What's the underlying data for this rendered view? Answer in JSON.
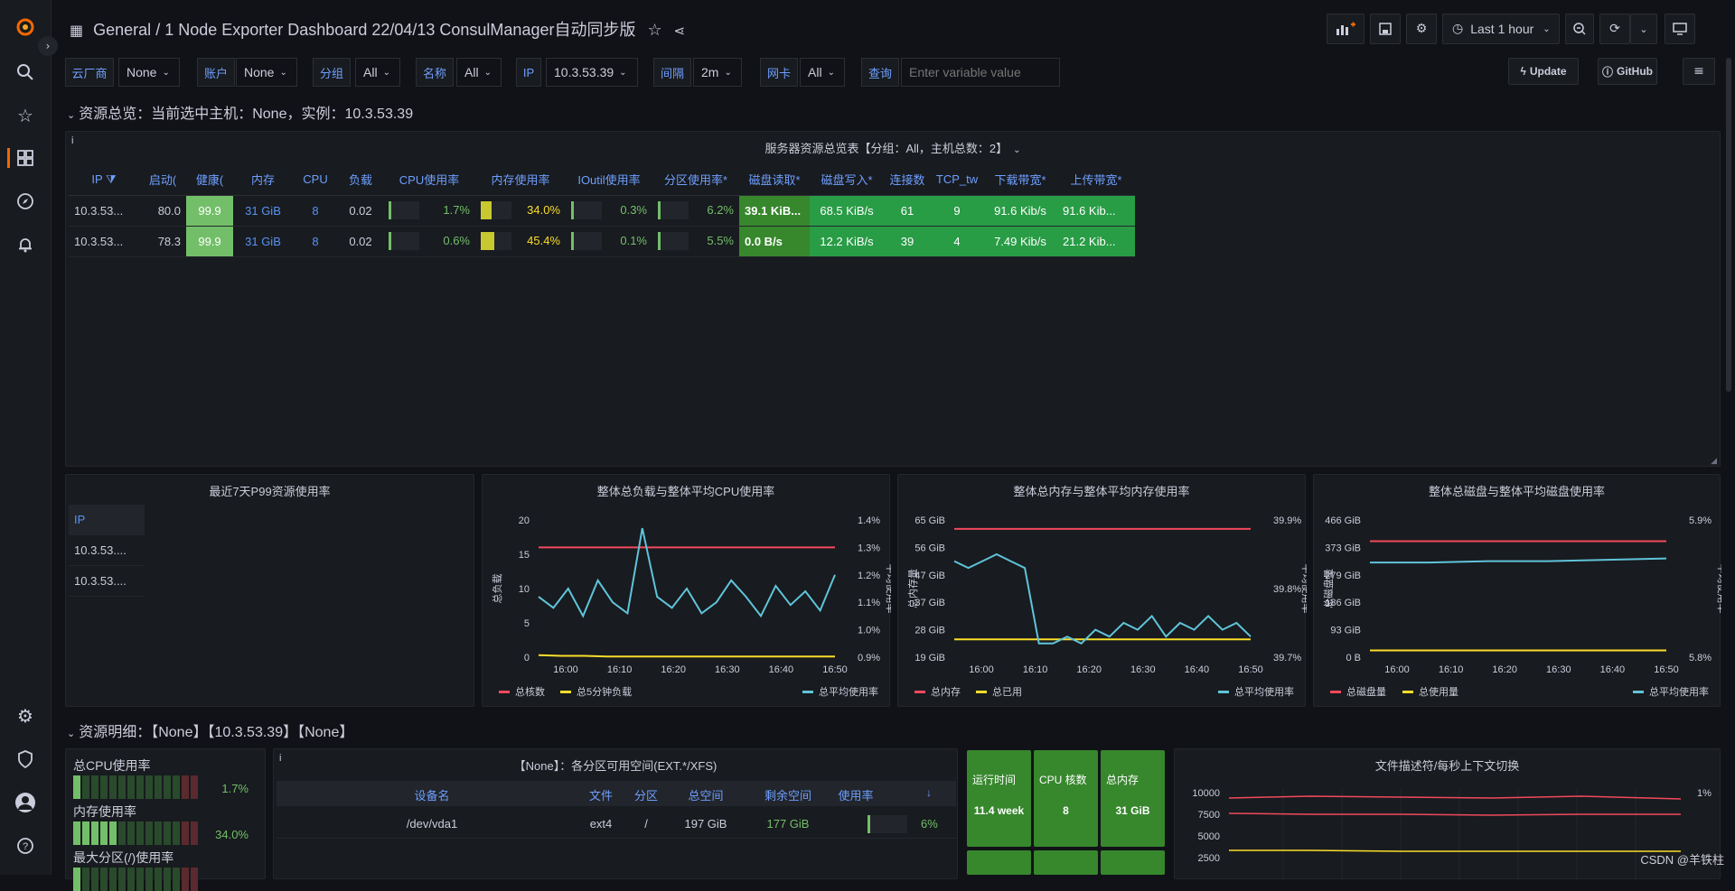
{
  "header": {
    "breadcrumb_root": "General",
    "breadcrumb_sep": " / ",
    "dashboard_title": "1 Node Exporter Dashboard 22/04/13 ConsulManager自动同步版",
    "time_range": "Last 1 hour"
  },
  "variables": [
    {
      "label": "云厂商",
      "value": "None"
    },
    {
      "label": "账户",
      "value": "None"
    },
    {
      "label": "分组",
      "value": "All"
    },
    {
      "label": "名称",
      "value": "All"
    },
    {
      "label": "IP",
      "value": "10.3.53.39"
    },
    {
      "label": "间隔",
      "value": "2m"
    },
    {
      "label": "网卡",
      "value": "All"
    },
    {
      "label": "查询",
      "placeholder": "Enter variable value"
    }
  ],
  "buttons": {
    "update": "Update",
    "github": "GitHub"
  },
  "rows": {
    "overview": "资源总览：当前选中主机：None，实例：10.3.53.39",
    "detail": "资源明细：【None】【10.3.53.39】【None】"
  },
  "server_table": {
    "title": "服务器资源总览表【分组：All，主机总数：2】",
    "columns": [
      "IP",
      "启动(",
      "健康(",
      "内存",
      "CPU",
      "负载",
      "CPU使用率",
      "内存使用率",
      "IOutil使用率",
      "分区使用率*",
      "磁盘读取*",
      "磁盘写入*",
      "连接数",
      "TCP_tw",
      "下载带宽*",
      "上传带宽*"
    ],
    "rows": [
      {
        "ip": "10.3.53...",
        "uptime": "80.0",
        "health": "99.9",
        "mem": "31 GiB",
        "cpu": "8",
        "load": "0.02",
        "cpu_pct": "1.7%",
        "cpu_frac": 0.017,
        "mem_pct": "34.0%",
        "mem_frac": 0.34,
        "io_pct": "0.3%",
        "io_frac": 0.003,
        "part_pct": "6.2%",
        "part_frac": 0.062,
        "disk_read": "39.1 KiB...",
        "disk_write": "68.5 KiB/s",
        "conn": "61",
        "tcp_tw": "9",
        "down": "91.6 Kib/s",
        "up": "91.6 Kib..."
      },
      {
        "ip": "10.3.53...",
        "uptime": "78.3",
        "health": "99.9",
        "mem": "31 GiB",
        "cpu": "8",
        "load": "0.02",
        "cpu_pct": "0.6%",
        "cpu_frac": 0.006,
        "mem_pct": "45.4%",
        "mem_frac": 0.454,
        "io_pct": "0.1%",
        "io_frac": 0.001,
        "part_pct": "5.5%",
        "part_frac": 0.055,
        "disk_read": "0.0 B/s",
        "disk_write": "12.2 KiB/s",
        "conn": "39",
        "tcp_tw": "4",
        "down": "7.49 Kib/s",
        "up": "21.2 Kib..."
      }
    ]
  },
  "p99_panel": {
    "title": "最近7天P99资源使用率",
    "header": "IP",
    "rows": [
      "10.3.53....",
      "10.3.53...."
    ]
  },
  "chart_data": [
    {
      "type": "line",
      "title": "整体总负载与整体平均CPU使用率",
      "ylabel": "总负载",
      "y2label": "平均使用率",
      "x": [
        "16:00",
        "16:10",
        "16:20",
        "16:30",
        "16:40",
        "16:50"
      ],
      "ylim": [
        0,
        20
      ],
      "y_ticks": [
        "0",
        "5",
        "10",
        "15",
        "20"
      ],
      "y2lim": [
        0.9,
        1.4
      ],
      "y2_ticks": [
        "0.9%",
        "1.0%",
        "1.1%",
        "1.2%",
        "1.3%",
        "1.4%"
      ],
      "series": [
        {
          "name": "总核数",
          "color": "#f2495c",
          "axis": "left",
          "values": [
            16,
            16,
            16,
            16,
            16,
            16,
            16,
            16,
            16,
            16,
            16,
            16,
            16,
            16
          ]
        },
        {
          "name": "总5分钟负载",
          "color": "#fade2a",
          "axis": "left",
          "values": [
            0.3,
            0.2,
            0.2,
            0.1,
            0.1,
            0.1,
            0.1,
            0.1,
            0.1,
            0.1,
            0.1,
            0.1,
            0.1,
            0.1
          ]
        },
        {
          "name": "总平均使用率",
          "color": "#5fc4da",
          "axis": "right",
          "values": [
            1.12,
            1.08,
            1.15,
            1.05,
            1.18,
            1.1,
            1.06,
            1.37,
            1.12,
            1.08,
            1.15,
            1.06,
            1.1,
            1.18,
            1.12,
            1.05,
            1.16,
            1.09,
            1.14,
            1.07,
            1.2
          ]
        }
      ]
    },
    {
      "type": "line",
      "title": "整体总内存与整体平均内存使用率",
      "ylabel": "总内存量",
      "y2label": "平均使用率",
      "x": [
        "16:00",
        "16:10",
        "16:20",
        "16:30",
        "16:40",
        "16:50"
      ],
      "ylim": [
        19,
        65
      ],
      "y_ticks": [
        "19 GiB",
        "28 GiB",
        "37 GiB",
        "47 GiB",
        "56 GiB",
        "65 GiB"
      ],
      "y2lim": [
        39.7,
        39.9
      ],
      "y2_ticks": [
        "39.7%",
        "39.8%",
        "39.9%"
      ],
      "series": [
        {
          "name": "总内存",
          "color": "#f2495c",
          "axis": "left",
          "values": [
            62,
            62,
            62,
            62,
            62,
            62,
            62,
            62,
            62,
            62,
            62,
            62,
            62,
            62
          ]
        },
        {
          "name": "总已用",
          "color": "#fade2a",
          "axis": "left",
          "values": [
            25,
            25,
            25,
            25,
            25,
            25,
            25,
            25,
            25,
            25,
            25,
            25,
            25,
            25
          ]
        },
        {
          "name": "总平均使用率",
          "color": "#5fc4da",
          "axis": "right",
          "values": [
            39.84,
            39.83,
            39.84,
            39.85,
            39.84,
            39.83,
            39.72,
            39.72,
            39.73,
            39.72,
            39.74,
            39.73,
            39.75,
            39.74,
            39.76,
            39.73,
            39.75,
            39.74,
            39.76,
            39.74,
            39.75,
            39.73
          ]
        }
      ]
    },
    {
      "type": "line",
      "title": "整体总磁盘与整体平均磁盘使用率",
      "ylabel": "总磁盘量",
      "y2label": "平均使用率",
      "x": [
        "16:00",
        "16:10",
        "16:20",
        "16:30",
        "16:40",
        "16:50"
      ],
      "ylim": [
        0,
        466
      ],
      "y_ticks": [
        "0 B",
        "93 GiB",
        "186 GiB",
        "279 GiB",
        "373 GiB",
        "466 GiB"
      ],
      "y2lim": [
        5.8,
        5.9
      ],
      "y2_ticks": [
        "5.8%",
        "5.9%"
      ],
      "series": [
        {
          "name": "总磁盘量",
          "color": "#f2495c",
          "axis": "left",
          "values": [
            394,
            394,
            394,
            394,
            394,
            394
          ]
        },
        {
          "name": "总使用量",
          "color": "#fade2a",
          "axis": "left",
          "values": [
            23,
            23,
            23,
            23,
            23,
            23
          ]
        },
        {
          "name": "总平均使用率",
          "color": "#5fc4da",
          "axis": "right",
          "values": [
            5.869,
            5.869,
            5.87,
            5.87,
            5.871,
            5.872
          ]
        }
      ]
    }
  ],
  "gauges": [
    {
      "label": "总CPU使用率",
      "value": "1.7%",
      "frac": 0.017
    },
    {
      "label": "内存使用率",
      "value": "34.0%",
      "frac": 0.34
    },
    {
      "label": "最大分区(/)使用率",
      "value": "",
      "frac": 0.06
    }
  ],
  "partition_panel": {
    "title": "【None】：各分区可用空间(EXT.*/XFS)",
    "columns": [
      "设备名",
      "文件",
      "分区",
      "总空间",
      "剩余空间",
      "使用率"
    ],
    "rows": [
      {
        "dev": "/dev/vda1",
        "fs": "ext4",
        "mount": "/",
        "total": "197 GiB",
        "free": "177 GiB",
        "pct": "6%",
        "frac": 0.06
      }
    ]
  },
  "stats": [
    {
      "label": "运行时间",
      "value": "11.4 week"
    },
    {
      "label": "CPU 核数",
      "value": "8"
    },
    {
      "label": "总内存",
      "value": "31 GiB"
    }
  ],
  "fd_panel": {
    "title": "文件描述符/每秒上下文切换",
    "y_ticks": [
      "10000",
      "7500",
      "5000",
      "2500"
    ],
    "y2_tick": "1%"
  },
  "watermark": "CSDN @羊铁柱"
}
